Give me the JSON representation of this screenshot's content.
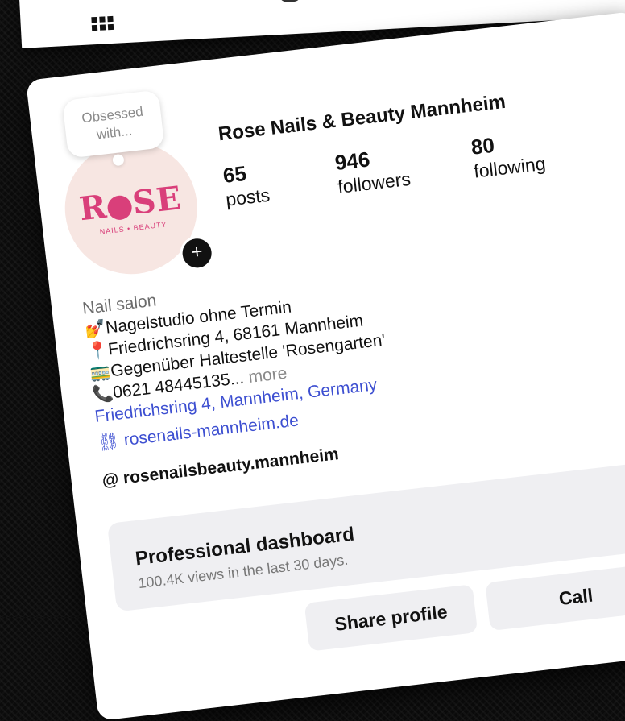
{
  "note": {
    "text": "Obsessed with..."
  },
  "logo": {
    "text_before": "R",
    "text_after": "SE",
    "subtitle": "NAILS • BEAUTY"
  },
  "profile": {
    "name": "Rose Nails & Beauty Mannheim"
  },
  "stats": [
    {
      "value": "65",
      "label": "posts"
    },
    {
      "value": "946",
      "label": "followers"
    },
    {
      "value": "80",
      "label": "following"
    }
  ],
  "bio": {
    "category": "Nail salon",
    "lines": [
      {
        "icon": "nail-polish-icon",
        "glyph": "💅",
        "text": "Nagelstudio ohne Termin"
      },
      {
        "icon": "pin-icon",
        "glyph": "📍",
        "text": "Friedrichsring 4, 68161 Mannheim"
      },
      {
        "icon": "tram-icon",
        "glyph": "🚃",
        "text": "Gegenüber Haltestelle 'Rosengarten'"
      },
      {
        "icon": "phone-icon",
        "glyph": "📞",
        "text": "0621 48445135...",
        "more": "more"
      }
    ],
    "address_link": "Friedrichsring 4, Mannheim, Germany",
    "website": "rosenails-mannheim.de",
    "threads": "rosenailsbeauty.mannheim"
  },
  "dashboard": {
    "title": "Professional dashboard",
    "subtitle": "100.4K views in the last 30 days."
  },
  "buttons": {
    "share": "Share profile",
    "call": "Call"
  }
}
